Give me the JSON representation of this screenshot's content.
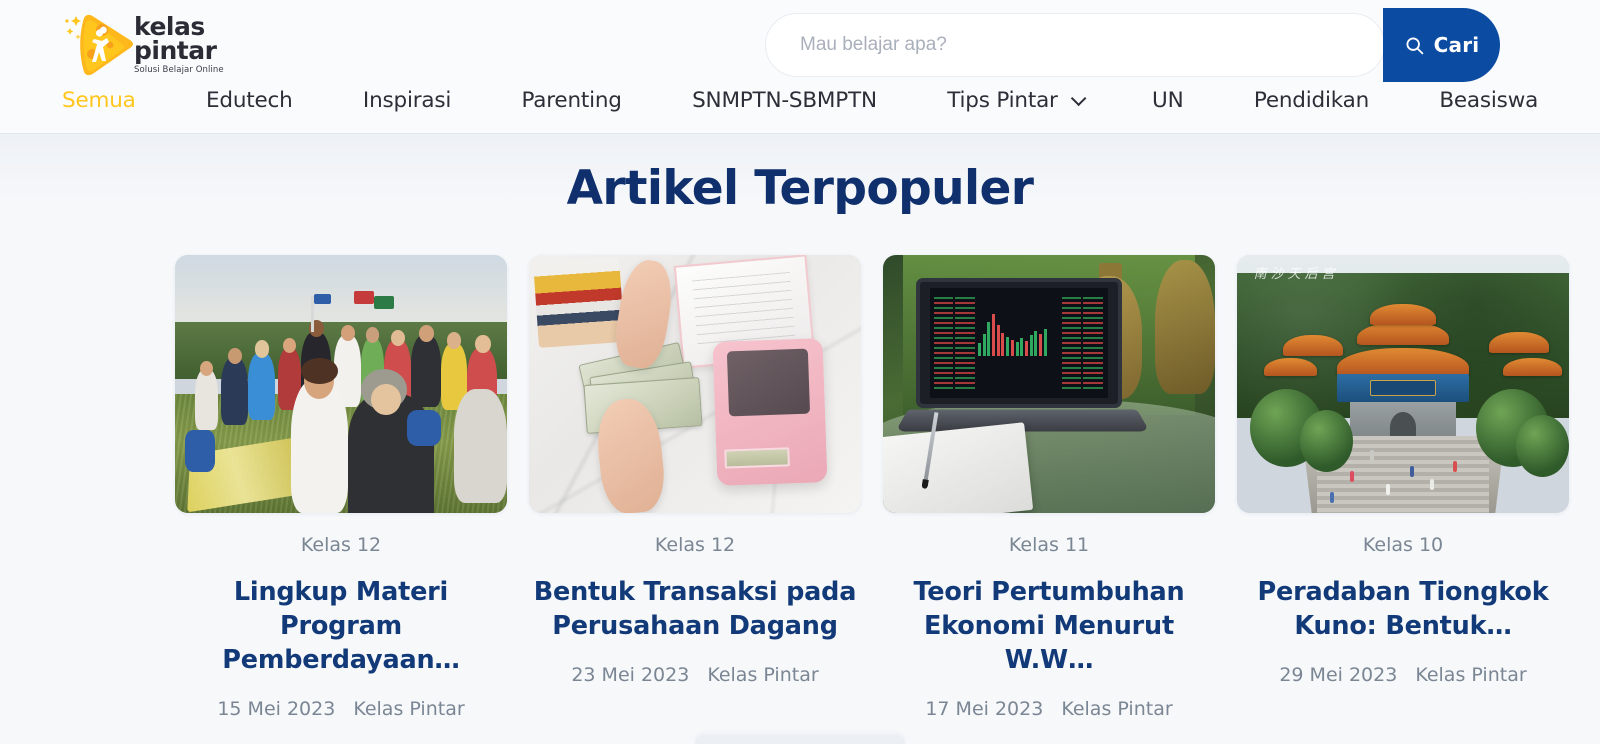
{
  "brand": {
    "logo_line1": "kelas",
    "logo_line2": "pintar",
    "tagline": "Solusi Belajar Online",
    "logo_icon": "play-triangle-person-logo",
    "accent_yellow": "#FFC61E",
    "accent_blue": "#0B4BA2",
    "title_navy": "#10306D"
  },
  "search": {
    "placeholder": "Mau belajar apa?",
    "value": "",
    "button_label": "Cari",
    "button_icon": "search-icon"
  },
  "nav": {
    "items": [
      {
        "label": "Semua",
        "active": true,
        "has_dropdown": false
      },
      {
        "label": "Edutech",
        "active": false,
        "has_dropdown": false
      },
      {
        "label": "Inspirasi",
        "active": false,
        "has_dropdown": false
      },
      {
        "label": "Parenting",
        "active": false,
        "has_dropdown": false
      },
      {
        "label": "SNMPTN-SBMPTN",
        "active": false,
        "has_dropdown": false
      },
      {
        "label": "Tips Pintar",
        "active": false,
        "has_dropdown": true
      },
      {
        "label": "UN",
        "active": false,
        "has_dropdown": false
      },
      {
        "label": "Pendidikan",
        "active": false,
        "has_dropdown": false
      },
      {
        "label": "Beasiswa",
        "active": false,
        "has_dropdown": false
      }
    ]
  },
  "main": {
    "heading": "Artikel Terpopuler",
    "cards": [
      {
        "grade": "Kelas 12",
        "title": "Lingkup Materi Program Pemberdayaan…",
        "date": "15 Mei 2023",
        "author": "Kelas Pintar",
        "image_alt": "crowd-of-people-sitting-in-grass-field"
      },
      {
        "grade": "Kelas 12",
        "title": "Bentuk Transaksi pada Perusahaan Dagang",
        "date": "23 Mei 2023",
        "author": "Kelas Pintar",
        "image_alt": "hands-holding-dollar-bills-with-pink-calculator"
      },
      {
        "grade": "Kelas 11",
        "title": "Teori Pertumbuhan Ekonomi Menurut W.W…",
        "date": "17 Mei 2023",
        "author": "Kelas Pintar",
        "image_alt": "laptop-showing-stock-trading-chart-on-glass-table"
      },
      {
        "grade": "Kelas 10",
        "title": "Peradaban Tiongkok Kuno: Bentuk…",
        "date": "29 Mei 2023",
        "author": "Kelas Pintar",
        "image_alt": "ancient-chinese-temple-gate-with-stone-stairs"
      }
    ]
  }
}
